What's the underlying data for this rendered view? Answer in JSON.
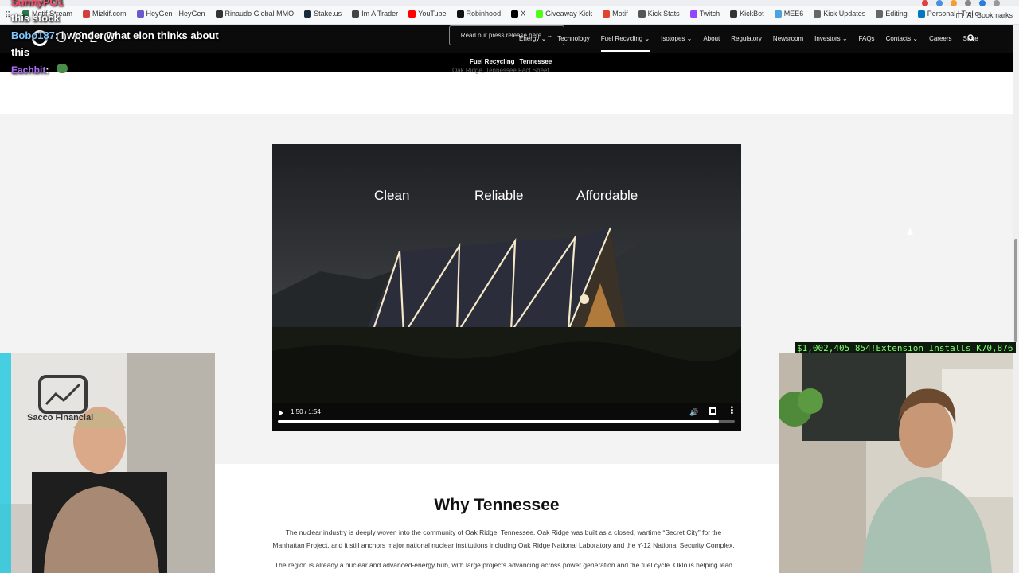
{
  "browser": {
    "apps_label": "⠿",
    "bookmarks": [
      {
        "label": "Motif Stream",
        "color": "#2b7a4b"
      },
      {
        "label": "Mizkif.com",
        "color": "#d04040"
      },
      {
        "label": "HeyGen - HeyGen",
        "color": "#6a5acd"
      },
      {
        "label": "Rinaudo Global MMO",
        "color": "#333333"
      },
      {
        "label": "Stake.us",
        "color": "#1b2a3a"
      },
      {
        "label": "Im A Trader",
        "color": "#444444"
      },
      {
        "label": "YouTube",
        "color": "#ff0000"
      },
      {
        "label": "Robinhood",
        "color": "#111111"
      },
      {
        "label": "X",
        "color": "#000000"
      },
      {
        "label": "Giveaway Kick",
        "color": "#53fc18"
      },
      {
        "label": "Motif",
        "color": "#e0442e"
      },
      {
        "label": "Kick Stats",
        "color": "#555555"
      },
      {
        "label": "Twitch",
        "color": "#9146ff"
      },
      {
        "label": "KickBot",
        "color": "#333333"
      },
      {
        "label": "MEE6",
        "color": "#4aa3df"
      },
      {
        "label": "Kick Updates",
        "color": "#666666"
      },
      {
        "label": "Editing",
        "color": "#666666"
      },
      {
        "label": "Personal | Trello",
        "color": "#0079bf"
      }
    ],
    "all_bookmarks": "All Bookmarks"
  },
  "site": {
    "logo_text": "OKLO",
    "press_release": "Read our press release here",
    "press_arrow": "→",
    "nav": [
      {
        "label": "Energy ⌄",
        "active": false
      },
      {
        "label": "Technology",
        "active": false
      },
      {
        "label": "Fuel Recycling ⌄",
        "active": true
      },
      {
        "label": "Isotopes ⌄",
        "active": false
      },
      {
        "label": "About",
        "active": false
      },
      {
        "label": "Regulatory",
        "active": false
      },
      {
        "label": "Newsroom",
        "active": false
      },
      {
        "label": "Investors ⌄",
        "active": false
      },
      {
        "label": "FAQs",
        "active": false
      },
      {
        "label": "Contacts ⌄",
        "active": false
      },
      {
        "label": "Careers",
        "active": false
      },
      {
        "label": "Store",
        "active": false
      }
    ],
    "subnav": [
      "Fuel Recycling",
      "Tennessee"
    ],
    "factsheet": "Oak Ridge, Tennessee Fact Sheet"
  },
  "video": {
    "words": [
      "Clean",
      "Reliable",
      "Affordable"
    ],
    "time": "1:50 / 1:54",
    "progress": 0.965
  },
  "section": {
    "title": "Why Tennessee",
    "paragraphs": [
      "The nuclear industry is deeply woven into the community of Oak Ridge, Tennessee. Oak Ridge was built as a closed, wartime “Secret City” for the Manhattan Project, and it still anchors major national nuclear institutions including Oak Ridge National Laboratory and the Y-12 National Security Complex.",
      "The region is already a nuclear and advanced-energy hub, with large projects advancing across power generation and the fuel cycle. Oklo is helping lead"
    ]
  },
  "stream": {
    "chat": [
      {
        "user": "SunnyPO1",
        "text": "",
        "color": "#ff4d6d"
      },
      {
        "user": "",
        "text": "this stock",
        "color": "#ffffff"
      },
      {
        "user": "Bobo187",
        "text": ": i wonder what elon thinks about",
        "color": "#7ec8ff"
      },
      {
        "user": "",
        "text": "this",
        "color": "#ffffff"
      },
      {
        "user": "Eachbit",
        "text": ":",
        "color": "#b36bff"
      }
    ],
    "ticker_money": "$1,002,405",
    "ticker_extension": "854!Extension Installs",
    "ticker_kick": "K70,876",
    "left_cam_sign": "Sacco Financial"
  }
}
